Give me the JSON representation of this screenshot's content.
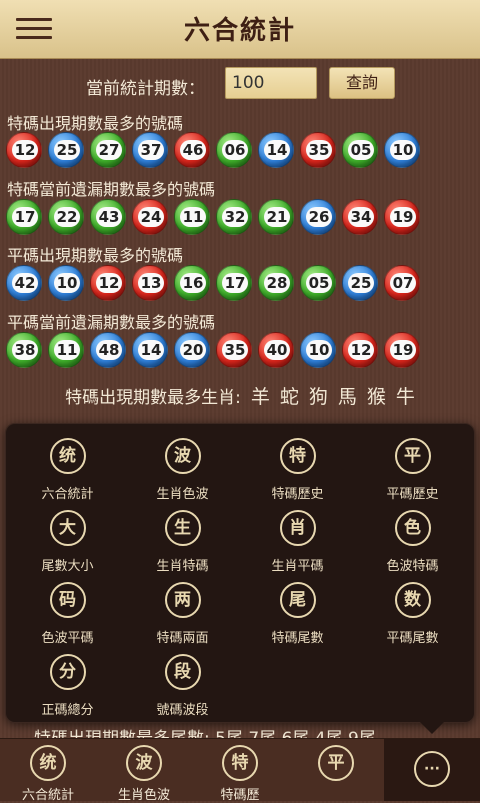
{
  "header": {
    "title": "六合統計"
  },
  "query": {
    "label": "當前統計期數：",
    "value": "100",
    "button": "查詢"
  },
  "sections": [
    {
      "title": "特碼出現期數最多的號碼",
      "balls": [
        [
          "12",
          "red"
        ],
        [
          "25",
          "blue"
        ],
        [
          "27",
          "green"
        ],
        [
          "37",
          "blue"
        ],
        [
          "46",
          "red"
        ],
        [
          "06",
          "green"
        ],
        [
          "14",
          "blue"
        ],
        [
          "35",
          "red"
        ],
        [
          "05",
          "green"
        ],
        [
          "10",
          "blue"
        ]
      ]
    },
    {
      "title": "特碼當前遺漏期數最多的號碼",
      "balls": [
        [
          "17",
          "green"
        ],
        [
          "22",
          "green"
        ],
        [
          "43",
          "green"
        ],
        [
          "24",
          "red"
        ],
        [
          "11",
          "green"
        ],
        [
          "32",
          "green"
        ],
        [
          "21",
          "green"
        ],
        [
          "26",
          "blue"
        ],
        [
          "34",
          "red"
        ],
        [
          "19",
          "red"
        ]
      ]
    },
    {
      "title": "平碼出現期數最多的號碼",
      "balls": [
        [
          "42",
          "blue"
        ],
        [
          "10",
          "blue"
        ],
        [
          "12",
          "red"
        ],
        [
          "13",
          "red"
        ],
        [
          "16",
          "green"
        ],
        [
          "17",
          "green"
        ],
        [
          "28",
          "green"
        ],
        [
          "05",
          "green"
        ],
        [
          "25",
          "blue"
        ],
        [
          "07",
          "red"
        ]
      ]
    },
    {
      "title": "平碼當前遺漏期數最多的號碼",
      "balls": [
        [
          "38",
          "green"
        ],
        [
          "11",
          "green"
        ],
        [
          "48",
          "blue"
        ],
        [
          "14",
          "blue"
        ],
        [
          "20",
          "blue"
        ],
        [
          "35",
          "red"
        ],
        [
          "40",
          "red"
        ],
        [
          "10",
          "blue"
        ],
        [
          "12",
          "red"
        ],
        [
          "19",
          "red"
        ]
      ]
    }
  ],
  "zodiac": {
    "label": "特碼出現期數最多生肖:",
    "items": [
      "羊",
      "蛇",
      "狗",
      "馬",
      "猴",
      "牛"
    ]
  },
  "bottom_text": "特碼出現期數最多尾數: 5尾  7尾  6尾  4尾  9尾",
  "popup": [
    {
      "icon": "统",
      "label": "六合統計"
    },
    {
      "icon": "波",
      "label": "生肖色波"
    },
    {
      "icon": "特",
      "label": "特碼歷史"
    },
    {
      "icon": "平",
      "label": "平碼歷史"
    },
    {
      "icon": "大",
      "label": "尾數大小"
    },
    {
      "icon": "生",
      "label": "生肖特碼"
    },
    {
      "icon": "肖",
      "label": "生肖平碼"
    },
    {
      "icon": "色",
      "label": "色波特碼"
    },
    {
      "icon": "码",
      "label": "色波平碼"
    },
    {
      "icon": "两",
      "label": "特碼兩面"
    },
    {
      "icon": "尾",
      "label": "特碼尾數"
    },
    {
      "icon": "数",
      "label": "平碼尾數"
    },
    {
      "icon": "分",
      "label": "正碼總分"
    },
    {
      "icon": "段",
      "label": "號碼波段"
    }
  ],
  "bottom_nav": [
    {
      "icon": "统",
      "label": "六合統計"
    },
    {
      "icon": "波",
      "label": "生肖色波"
    },
    {
      "icon": "特",
      "label": "特碼歷"
    },
    {
      "icon": "平",
      "label": ""
    },
    {
      "icon": "···",
      "label": ""
    }
  ]
}
